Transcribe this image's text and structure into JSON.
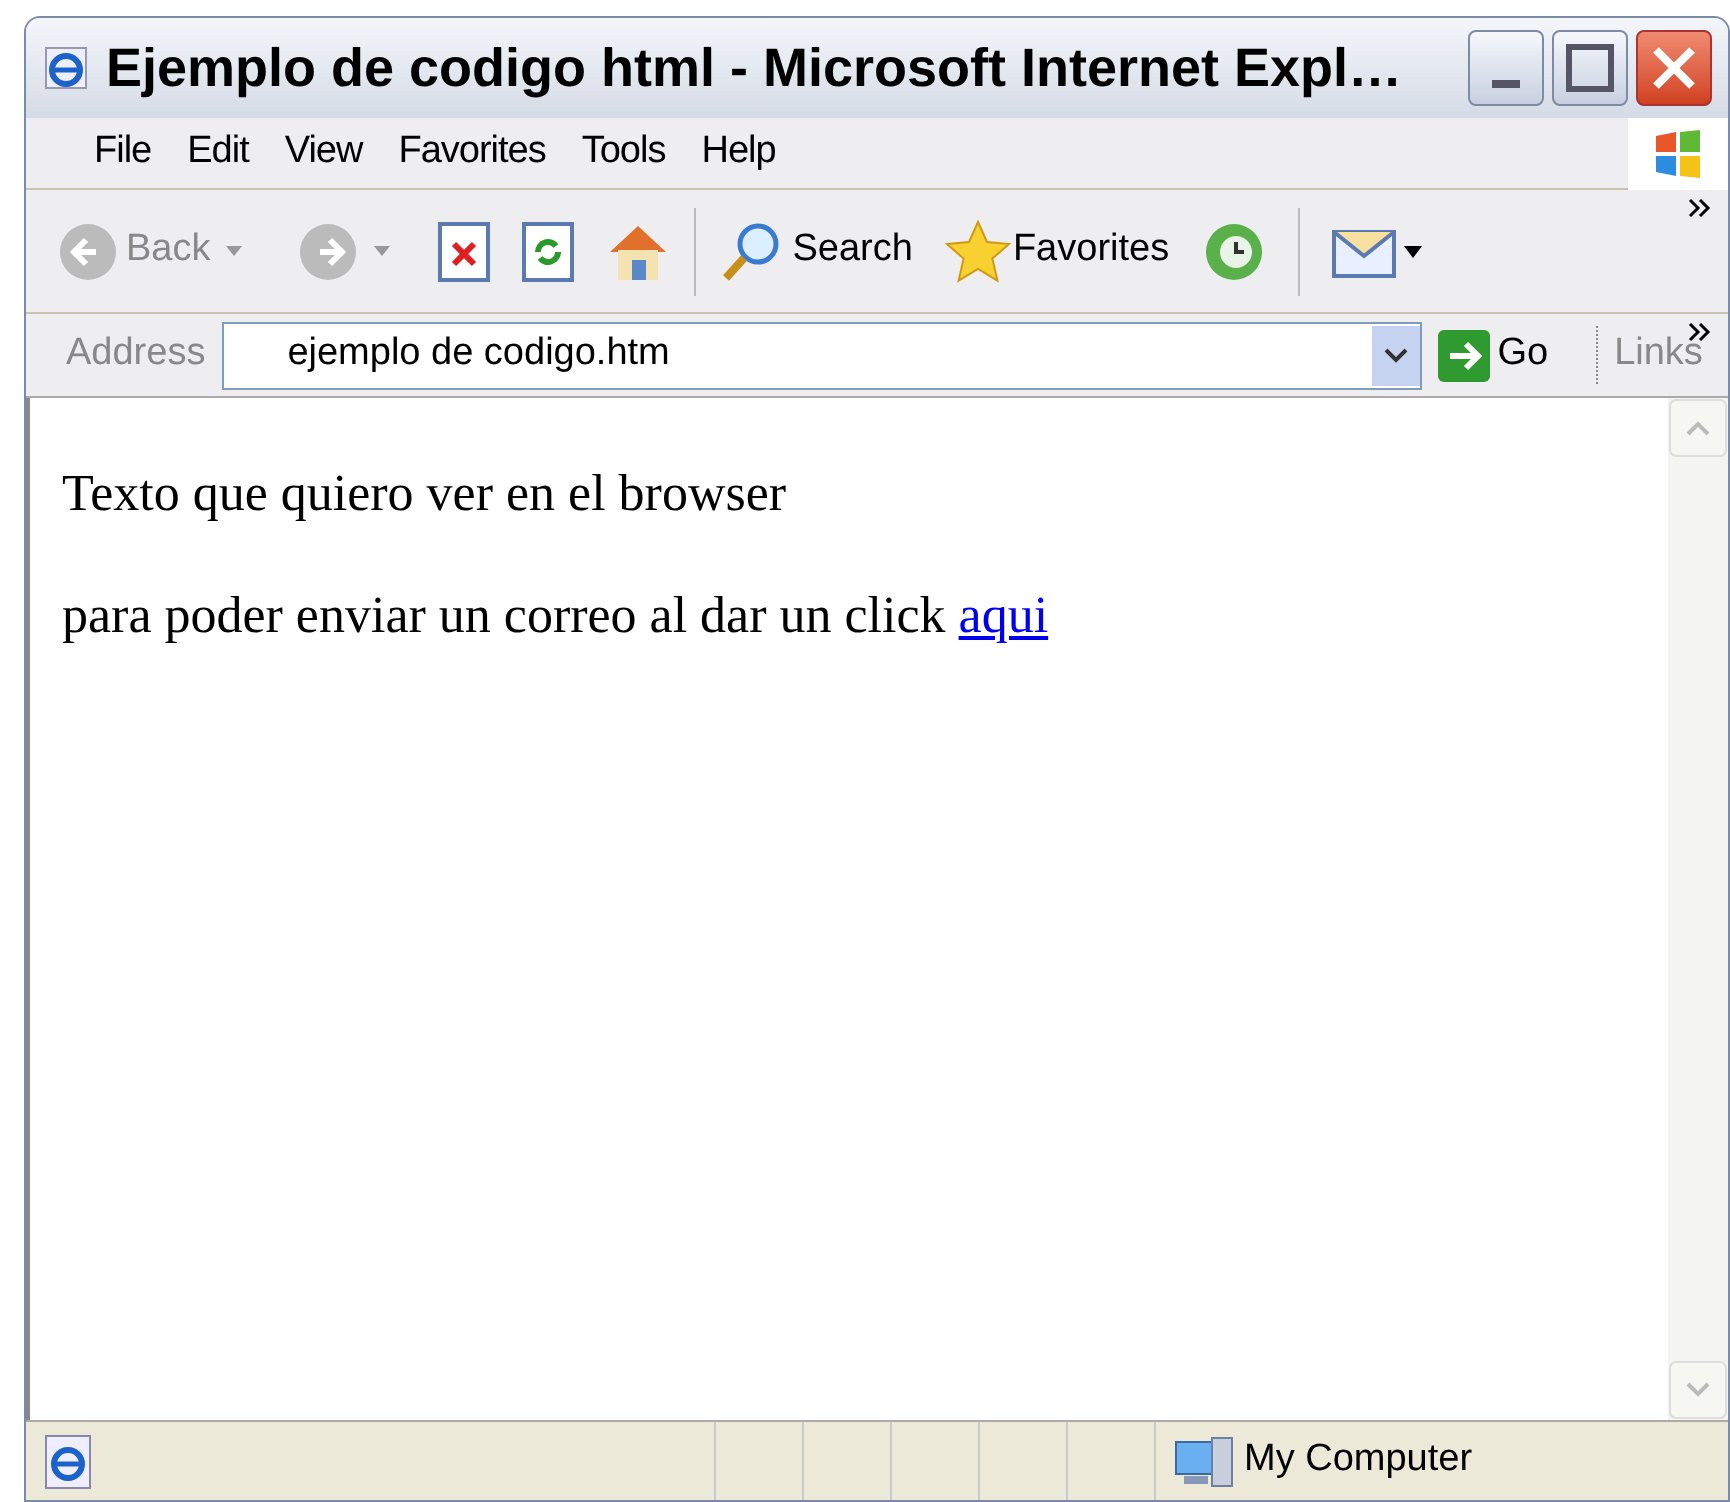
{
  "window": {
    "title": "Ejemplo de codigo html - Microsoft Internet Expl…"
  },
  "menu": [
    "File",
    "Edit",
    "View",
    "Favorites",
    "Tools",
    "Help"
  ],
  "toolbar": {
    "back": "Back",
    "search": "Search",
    "favorites": "Favorites"
  },
  "address_bar": {
    "label": "Address",
    "value": "ejemplo de codigo.htm",
    "go": "Go",
    "links": "Links"
  },
  "content": {
    "heading": "Texto que quiero ver en el browser",
    "paragraph": "para poder enviar un correo al dar un click",
    "link": "aqui"
  },
  "status_bar": {
    "zone": "My Computer"
  }
}
